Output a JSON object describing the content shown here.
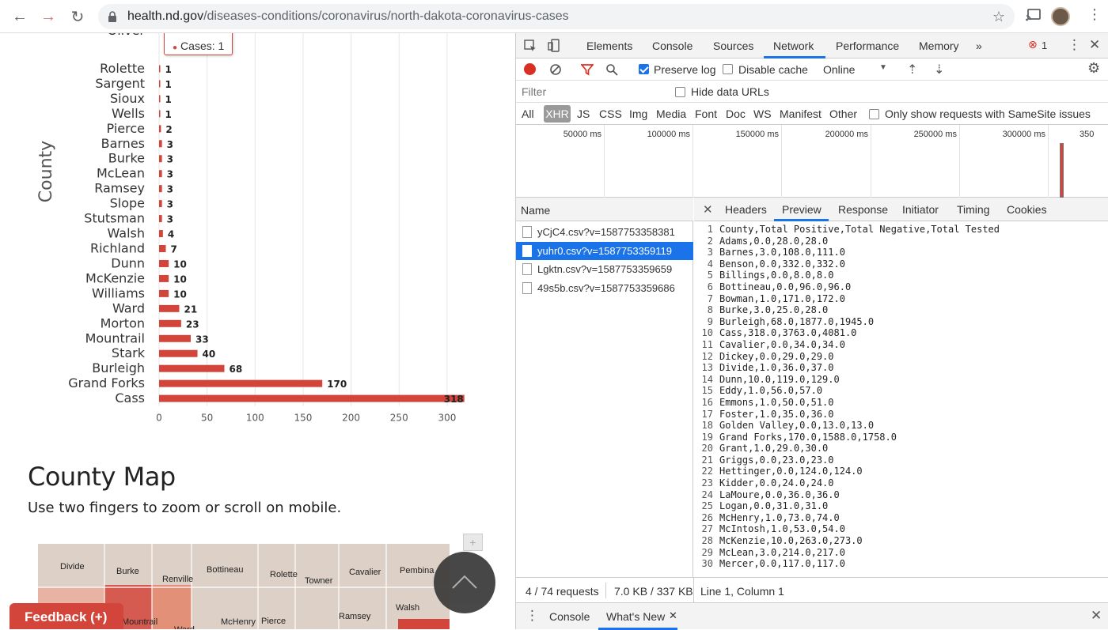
{
  "browser": {
    "url_host": "health.nd.gov",
    "url_path": "/diseases-conditions/coronavirus/north-dakota-coronavirus-cases"
  },
  "page": {
    "tooltip_text": "Cases: 1",
    "cut_off_label": "Oliver",
    "map_title": "County Map",
    "map_subtitle": "Use two fingers to zoom or scroll on mobile.",
    "feedback_label": "Feedback (+)",
    "map_zoom_label": "+",
    "map_labels": [
      "Divide",
      "Burke",
      "Renville",
      "Bottineau",
      "Rolette",
      "Towner",
      "Cavalier",
      "Pembina",
      "Mountrail",
      "Ward",
      "McHenry",
      "Pierce",
      "Ramsey",
      "Walsh"
    ],
    "accent_color": "#d3453a"
  },
  "chart_data": {
    "type": "bar",
    "orientation": "horizontal",
    "ylabel": "County",
    "categories": [
      "Rolette",
      "Sargent",
      "Sioux",
      "Wells",
      "Pierce",
      "Barnes",
      "Burke",
      "McLean",
      "Ramsey",
      "Slope",
      "Stutsman",
      "Walsh",
      "Richland",
      "Dunn",
      "McKenzie",
      "Williams",
      "Ward",
      "Morton",
      "Mountrail",
      "Stark",
      "Burleigh",
      "Grand Forks",
      "Cass"
    ],
    "values": [
      1,
      1,
      1,
      1,
      2,
      3,
      3,
      3,
      3,
      3,
      3,
      4,
      7,
      10,
      10,
      10,
      21,
      23,
      33,
      40,
      68,
      170,
      318
    ],
    "x_ticks": [
      0,
      50,
      100,
      150,
      200,
      250,
      300
    ],
    "xlim": [
      0,
      320
    ],
    "grid": true,
    "color": "#d3453a"
  },
  "devtools": {
    "tabs": [
      "Elements",
      "Console",
      "Sources",
      "Network",
      "Performance",
      "Memory",
      "»"
    ],
    "error_count": "1",
    "toolbar": {
      "preserve_log": "Preserve log",
      "disable_cache": "Disable cache",
      "throttle": "Online"
    },
    "filter": {
      "placeholder": "Filter",
      "hide_data_urls": "Hide data URLs"
    },
    "types": [
      "All",
      "XHR",
      "JS",
      "CSS",
      "Img",
      "Media",
      "Font",
      "Doc",
      "WS",
      "Manifest",
      "Other"
    ],
    "samesite_label": "Only show requests with SameSite issues",
    "timeline_labels": [
      "50000 ms",
      "100000 ms",
      "150000 ms",
      "200000 ms",
      "250000 ms",
      "300000 ms",
      "350"
    ],
    "name_header": "Name",
    "requests": [
      "yCjC4.csv?v=1587753358381",
      "yuhr0.csv?v=1587753359119",
      "Lgktn.csv?v=1587753359659",
      "49s5b.csv?v=1587753359686"
    ],
    "selected_request": 1,
    "detail_tabs": [
      "Headers",
      "Preview",
      "Response",
      "Initiator",
      "Timing",
      "Cookies"
    ],
    "preview_lines": [
      "County,Total Positive,Total Negative,Total Tested",
      "Adams,0.0,28.0,28.0",
      "Barnes,3.0,108.0,111.0",
      "Benson,0.0,332.0,332.0",
      "Billings,0.0,8.0,8.0",
      "Bottineau,0.0,96.0,96.0",
      "Bowman,1.0,171.0,172.0",
      "Burke,3.0,25.0,28.0",
      "Burleigh,68.0,1877.0,1945.0",
      "Cass,318.0,3763.0,4081.0",
      "Cavalier,0.0,34.0,34.0",
      "Dickey,0.0,29.0,29.0",
      "Divide,1.0,36.0,37.0",
      "Dunn,10.0,119.0,129.0",
      "Eddy,1.0,56.0,57.0",
      "Emmons,1.0,50.0,51.0",
      "Foster,1.0,35.0,36.0",
      "Golden Valley,0.0,13.0,13.0",
      "Grand Forks,170.0,1588.0,1758.0",
      "Grant,1.0,29.0,30.0",
      "Griggs,0.0,23.0,23.0",
      "Hettinger,0.0,124.0,124.0",
      "Kidder,0.0,24.0,24.0",
      "LaMoure,0.0,36.0,36.0",
      "Logan,0.0,31.0,31.0",
      "McHenry,1.0,73.0,74.0",
      "McIntosh,1.0,53.0,54.0",
      "McKenzie,10.0,263.0,273.0",
      "McLean,3.0,214.0,217.0",
      "Mercer,0.0,117.0,117.0"
    ],
    "status_requests": "4 / 74 requests",
    "status_size": "7.0 KB / 337 KB",
    "status_cursor": "Line 1, Column 1",
    "drawer_tabs": [
      "Console",
      "What's New"
    ]
  }
}
